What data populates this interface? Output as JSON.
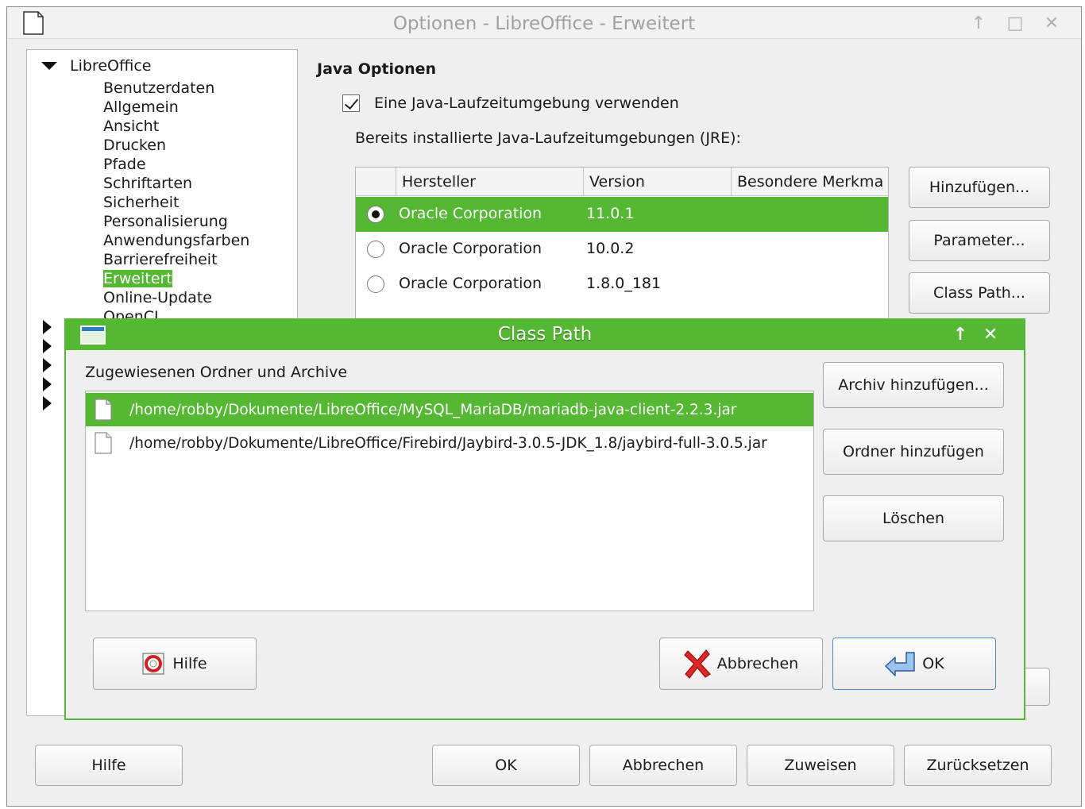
{
  "window": {
    "title": "Optionen - LibreOffice - Erweitert",
    "controls": {
      "up": "↑",
      "maximize": "□",
      "close": "✕"
    }
  },
  "tree": {
    "root": "LibreOffice",
    "items": [
      "Benutzerdaten",
      "Allgemein",
      "Ansicht",
      "Drucken",
      "Pfade",
      "Schriftarten",
      "Sicherheit",
      "Personalisierung",
      "Anwendungsfarben",
      "Barrierefreiheit",
      "Erweitert",
      "Online-Update",
      "OpenCL"
    ],
    "selected_index": 10
  },
  "java": {
    "section_title": "Java Optionen",
    "use_jre_label": "Eine Java-Laufzeitumgebung verwenden",
    "use_jre_checked": true,
    "installed_label": "Bereits installierte Java-Laufzeitumgebungen (JRE):",
    "columns": [
      "Hersteller",
      "Version",
      "Besondere Merkma"
    ],
    "rows": [
      {
        "vendor": "Oracle Corporation",
        "version": "11.0.1",
        "selected": true
      },
      {
        "vendor": "Oracle Corporation",
        "version": "10.0.2",
        "selected": false
      },
      {
        "vendor": "Oracle Corporation",
        "version": "1.8.0_181",
        "selected": false
      }
    ],
    "buttons": {
      "add": "Hinzufügen...",
      "params": "Parameter...",
      "classpath": "Class Path..."
    }
  },
  "dialog": {
    "title": "Class Path",
    "list_label": "Zugewiesenen Ordner und Archive",
    "files": [
      {
        "path": "/home/robby/Dokumente/LibreOffice/MySQL_MariaDB/mariadb-java-client-2.2.3.jar",
        "selected": true
      },
      {
        "path": "/home/robby/Dokumente/LibreOffice/Firebird/Jaybird-3.0.5-JDK_1.8/jaybird-full-3.0.5.jar",
        "selected": false
      }
    ],
    "buttons": {
      "add_archive": "Archiv hinzufügen...",
      "add_folder": "Ordner hinzufügen",
      "delete": "Löschen",
      "help": "Hilfe",
      "cancel": "Abbrechen",
      "ok": "OK"
    }
  },
  "footer": {
    "help": "Hilfe",
    "ok": "OK",
    "cancel": "Abbrechen",
    "apply": "Zuweisen",
    "reset": "Zurücksetzen"
  },
  "colors": {
    "accent": "#54b833",
    "window_bg": "#efefef"
  }
}
